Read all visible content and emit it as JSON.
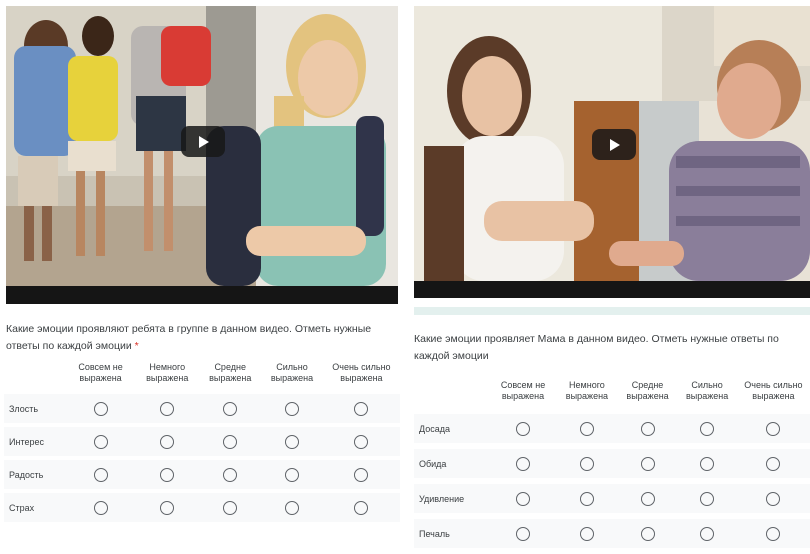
{
  "left": {
    "video": {
      "play_icon": "play-icon"
    },
    "question": "Какие эмоции проявляют ребята в группе в данном видео. Отметь нужные ответы по каждой эмоции",
    "required_mark": "*",
    "columns": [
      "Совсем не выражена",
      "Немного выражена",
      "Средне выражена",
      "Сильно выражена",
      "Очень сильно выражена"
    ],
    "rows": [
      "Злость",
      "Интерес",
      "Радость",
      "Страх"
    ]
  },
  "right": {
    "video": {
      "play_icon": "play-icon"
    },
    "question": "Какие эмоции проявляет Мама в данном видео. Отметь нужные ответы по каждой эмоции",
    "columns": [
      "Совсем не выражена",
      "Немного выражена",
      "Средне выражена",
      "Сильно выражена",
      "Очень сильно выражена"
    ],
    "rows": [
      "Досада",
      "Обида",
      "Удивление",
      "Печаль"
    ]
  }
}
